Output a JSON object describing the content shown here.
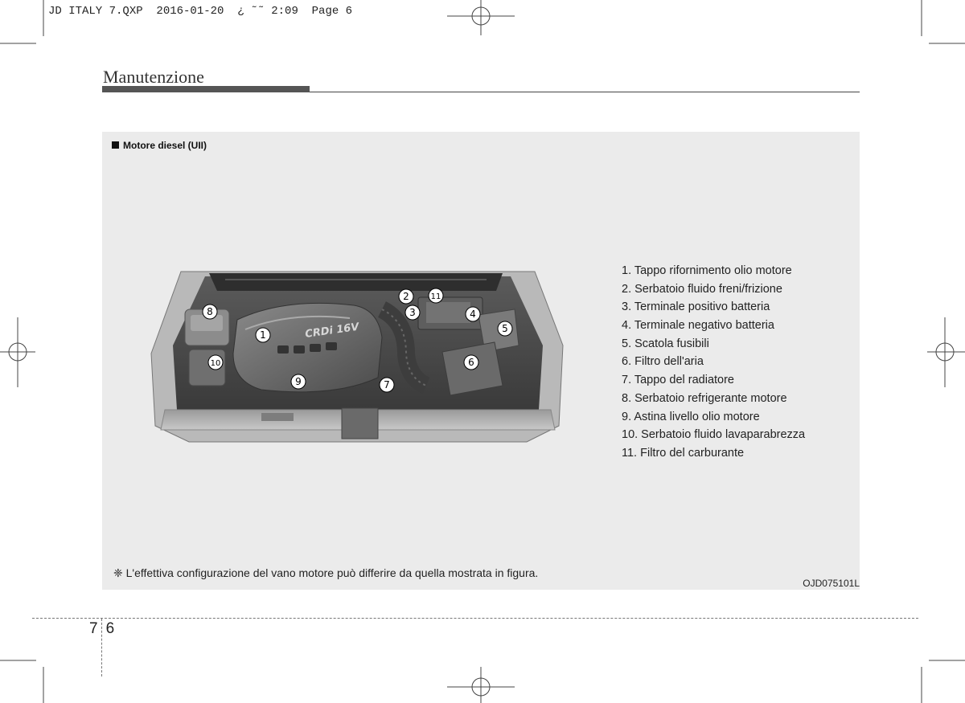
{
  "print_slug": "JD ITALY 7.QXP  2016-01-20  ¿ ˜˜ 2:09  Page 6",
  "section_title": "Manutenzione",
  "figure": {
    "heading": "Motore diesel (UII)",
    "callouts": [
      "1",
      "2",
      "3",
      "4",
      "5",
      "6",
      "7",
      "8",
      "9",
      "10",
      "11"
    ],
    "engine_cover_text": "CRDi 16V",
    "legend": [
      "1. Tappo rifornimento olio motore",
      "2. Serbatoio fluido freni/frizione",
      "3. Terminale positivo batteria",
      "4. Terminale negativo batteria",
      "5. Scatola fusibili",
      "6. Filtro dell'aria",
      "7. Tappo del radiatore",
      "8. Serbatoio refrigerante motore",
      "9. Astina livello olio motore",
      "10. Serbatoio fluido lavaparabrezza",
      "11. Filtro del carburante"
    ],
    "note": "❈ L'effettiva configurazione del vano motore può differire da quella mostrata in figura.",
    "image_code": "OJD075101L"
  },
  "page_number": {
    "chapter": "7",
    "page": "6"
  }
}
